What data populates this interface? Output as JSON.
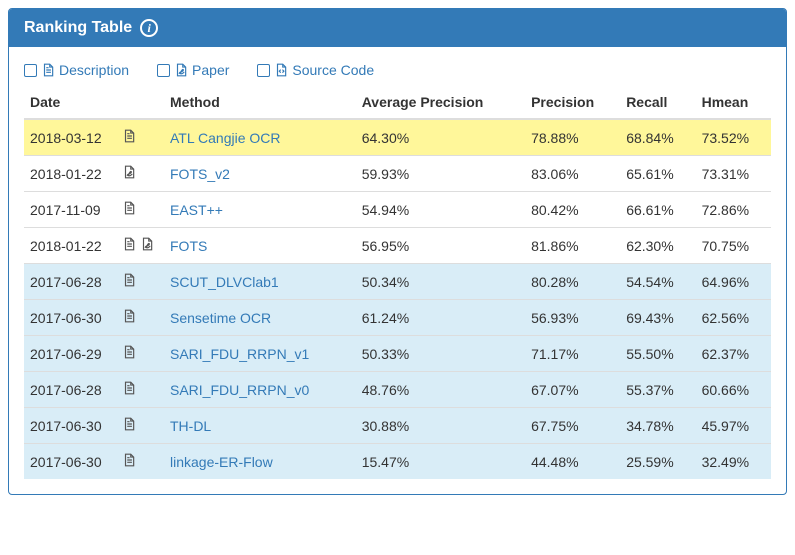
{
  "panel": {
    "title": "Ranking Table"
  },
  "legend": {
    "description": "Description",
    "paper": "Paper",
    "source_code": "Source Code"
  },
  "table": {
    "headers": {
      "date": "Date",
      "method": "Method",
      "avg_precision": "Average Precision",
      "precision": "Precision",
      "recall": "Recall",
      "hmean": "Hmean"
    },
    "rows": [
      {
        "date": "2018-03-12",
        "has_desc": true,
        "has_paper": false,
        "method": "ATL Cangjie OCR",
        "avg_precision": "64.30%",
        "precision": "78.88%",
        "recall": "68.84%",
        "hmean": "73.52%",
        "row_style": "hl"
      },
      {
        "date": "2018-01-22",
        "has_desc": false,
        "has_paper": true,
        "method": "FOTS_v2",
        "avg_precision": "59.93%",
        "precision": "83.06%",
        "recall": "65.61%",
        "hmean": "73.31%",
        "row_style": ""
      },
      {
        "date": "2017-11-09",
        "has_desc": true,
        "has_paper": false,
        "method": "EAST++",
        "avg_precision": "54.94%",
        "precision": "80.42%",
        "recall": "66.61%",
        "hmean": "72.86%",
        "row_style": ""
      },
      {
        "date": "2018-01-22",
        "has_desc": true,
        "has_paper": true,
        "method": "FOTS",
        "avg_precision": "56.95%",
        "precision": "81.86%",
        "recall": "62.30%",
        "hmean": "70.75%",
        "row_style": ""
      },
      {
        "date": "2017-06-28",
        "has_desc": true,
        "has_paper": false,
        "method": "SCUT_DLVClab1",
        "avg_precision": "50.34%",
        "precision": "80.28%",
        "recall": "54.54%",
        "hmean": "64.96%",
        "row_style": "alt"
      },
      {
        "date": "2017-06-30",
        "has_desc": true,
        "has_paper": false,
        "method": "Sensetime OCR",
        "avg_precision": "61.24%",
        "precision": "56.93%",
        "recall": "69.43%",
        "hmean": "62.56%",
        "row_style": "alt"
      },
      {
        "date": "2017-06-29",
        "has_desc": true,
        "has_paper": false,
        "method": "SARI_FDU_RRPN_v1",
        "avg_precision": "50.33%",
        "precision": "71.17%",
        "recall": "55.50%",
        "hmean": "62.37%",
        "row_style": "alt"
      },
      {
        "date": "2017-06-28",
        "has_desc": true,
        "has_paper": false,
        "method": "SARI_FDU_RRPN_v0",
        "avg_precision": "48.76%",
        "precision": "67.07%",
        "recall": "55.37%",
        "hmean": "60.66%",
        "row_style": "alt"
      },
      {
        "date": "2017-06-30",
        "has_desc": true,
        "has_paper": false,
        "method": "TH-DL",
        "avg_precision": "30.88%",
        "precision": "67.75%",
        "recall": "34.78%",
        "hmean": "45.97%",
        "row_style": "alt"
      },
      {
        "date": "2017-06-30",
        "has_desc": true,
        "has_paper": false,
        "method": "linkage-ER-Flow",
        "avg_precision": "15.47%",
        "precision": "44.48%",
        "recall": "25.59%",
        "hmean": "32.49%",
        "row_style": "alt"
      }
    ]
  }
}
